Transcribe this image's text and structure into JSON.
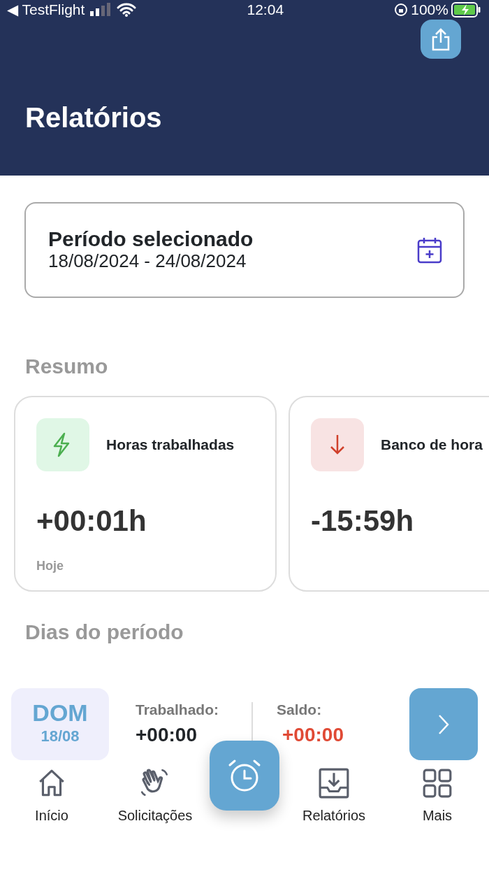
{
  "status_bar": {
    "back_app": "◀ TestFlight",
    "time": "12:04",
    "battery": "100%"
  },
  "header": {
    "title": "Relatórios"
  },
  "period": {
    "title": "Período selecionado",
    "range": "18/08/2024 - 24/08/2024"
  },
  "summary": {
    "heading": "Resumo",
    "cards": [
      {
        "kind": "worked",
        "color": "#4caf50",
        "title": "Horas trabalhadas",
        "value": "+00:01h",
        "note": "Hoje"
      },
      {
        "kind": "balance",
        "color": "#d0402b",
        "title": "Banco de hora",
        "value": "-15:59h"
      }
    ]
  },
  "days": {
    "heading": "Dias do período",
    "items": [
      {
        "weekday": "DOM",
        "date": "18/08",
        "worked_label": "Trabalhado:",
        "worked": "+00:00",
        "balance_label": "Saldo:",
        "balance": "+00:00"
      }
    ]
  },
  "tab_bar": {
    "items": [
      {
        "kind": "home",
        "label": "Início"
      },
      {
        "kind": "wave",
        "label": "Solicitações"
      },
      {
        "kind": "clock"
      },
      {
        "kind": "download",
        "label": "Relatórios"
      },
      {
        "kind": "grid",
        "label": "Mais"
      }
    ]
  }
}
